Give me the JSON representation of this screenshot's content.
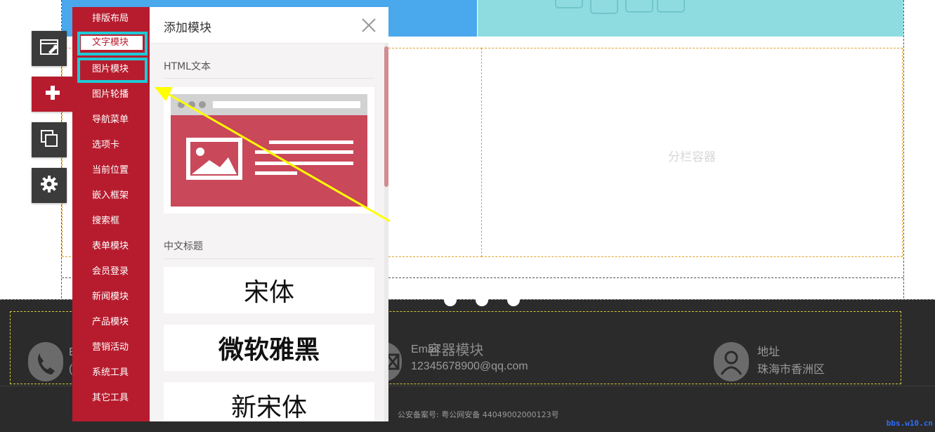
{
  "canvas": {
    "column_label": "分栏容器"
  },
  "toolbar": {
    "items": [
      {
        "name": "layout-edit",
        "icon": "window-wrench-icon"
      },
      {
        "name": "add-module",
        "icon": "plus-icon"
      },
      {
        "name": "copy-page",
        "icon": "copy-icon"
      },
      {
        "name": "settings",
        "icon": "gear-icon"
      }
    ]
  },
  "categories": {
    "items": [
      {
        "label": "排版布局"
      },
      {
        "label": "文字模块"
      },
      {
        "label": "图片模块"
      },
      {
        "label": "图片轮播"
      },
      {
        "label": "导航菜单"
      },
      {
        "label": "选项卡"
      },
      {
        "label": "当前位置"
      },
      {
        "label": "嵌入框架"
      },
      {
        "label": "搜索框"
      },
      {
        "label": "表单模块"
      },
      {
        "label": "会员登录"
      },
      {
        "label": "新闻模块"
      },
      {
        "label": "产品模块"
      },
      {
        "label": "营销活动"
      },
      {
        "label": "系统工具"
      },
      {
        "label": "其它工具"
      }
    ],
    "highlighted": [
      "文字模块",
      "图片模块"
    ]
  },
  "panel": {
    "title": "添加模块",
    "close_icon": "close-icon",
    "sections": [
      {
        "label": "HTML文本"
      },
      {
        "label": "中文标题"
      }
    ],
    "fonts": [
      {
        "label": "宋体"
      },
      {
        "label": "微软雅黑"
      },
      {
        "label": "新宋体"
      }
    ]
  },
  "footer": {
    "container_label": "容器模块",
    "phone": {
      "icon": "phone-icon"
    },
    "email": {
      "label": "Email",
      "value": "12345678900@qq.com",
      "icon": "email-icon"
    },
    "address": {
      "label": "地址",
      "value": "珠海市香洲区",
      "icon": "user-icon"
    },
    "icp": "公安备案号: 粤公网安备 44049002000123号"
  },
  "watermark": "bbs.w10.cn",
  "colors": {
    "brand_red": "#b71c2e",
    "highlight_cyan": "#1fc9d6",
    "arrow_yellow": "#ffff00"
  }
}
